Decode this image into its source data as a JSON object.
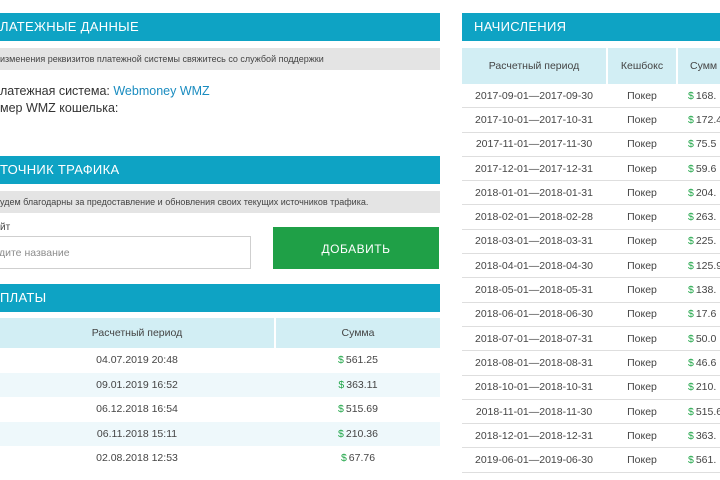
{
  "payment_details": {
    "header": "ЛАТЕЖНЫЕ ДАННЫЕ",
    "notice": "изменения реквизитов платежной системы свяжитесь со службой поддержки",
    "system_label": "латежная система:",
    "system_value": "Webmoney WMZ",
    "wallet_label": "мер WMZ кошелька:"
  },
  "traffic_source": {
    "header": "ТОЧНИК ТРАФИКА",
    "notice": "удем благодарны за предоставление и обновления своих текущих источников трафика.",
    "site_label": "йт",
    "input_placeholder": "дите название",
    "add_button": "ДОБАВИТЬ"
  },
  "payouts": {
    "header": "ПЛАТЫ",
    "columns": [
      "Расчетный период",
      "Сумма"
    ],
    "currency_symbol": "$",
    "rows": [
      {
        "period": "04.07.2019 20:48",
        "amount": "561.25"
      },
      {
        "period": "09.01.2019 16:52",
        "amount": "363.11"
      },
      {
        "period": "06.12.2018 16:54",
        "amount": "515.69"
      },
      {
        "period": "06.11.2018 15:11",
        "amount": "210.36"
      },
      {
        "period": "02.08.2018 12:53",
        "amount": "67.76"
      }
    ]
  },
  "accruals": {
    "header": "НАЧИСЛЕНИЯ",
    "columns": [
      "Расчетный период",
      "Кешбокс",
      "Сумм"
    ],
    "currency_symbol": "$",
    "rows": [
      {
        "period": "2017-09-01—2017-09-30",
        "cashbox": "Покер",
        "amount": "168."
      },
      {
        "period": "2017-10-01—2017-10-31",
        "cashbox": "Покер",
        "amount": "172.4"
      },
      {
        "period": "2017-11-01—2017-11-30",
        "cashbox": "Покер",
        "amount": "75.5"
      },
      {
        "period": "2017-12-01—2017-12-31",
        "cashbox": "Покер",
        "amount": "59.6"
      },
      {
        "period": "2018-01-01—2018-01-31",
        "cashbox": "Покер",
        "amount": "204."
      },
      {
        "period": "2018-02-01—2018-02-28",
        "cashbox": "Покер",
        "amount": "263."
      },
      {
        "period": "2018-03-01—2018-03-31",
        "cashbox": "Покер",
        "amount": "225."
      },
      {
        "period": "2018-04-01—2018-04-30",
        "cashbox": "Покер",
        "amount": "125.9"
      },
      {
        "period": "2018-05-01—2018-05-31",
        "cashbox": "Покер",
        "amount": "138."
      },
      {
        "period": "2018-06-01—2018-06-30",
        "cashbox": "Покер",
        "amount": "17.6"
      },
      {
        "period": "2018-07-01—2018-07-31",
        "cashbox": "Покер",
        "amount": "50.0"
      },
      {
        "period": "2018-08-01—2018-08-31",
        "cashbox": "Покер",
        "amount": "46.6"
      },
      {
        "period": "2018-10-01—2018-10-31",
        "cashbox": "Покер",
        "amount": "210."
      },
      {
        "period": "2018-11-01—2018-11-30",
        "cashbox": "Покер",
        "amount": "515.6"
      },
      {
        "period": "2018-12-01—2018-12-31",
        "cashbox": "Покер",
        "amount": "363."
      },
      {
        "period": "2019-06-01—2019-06-30",
        "cashbox": "Покер",
        "amount": "561."
      }
    ]
  }
}
